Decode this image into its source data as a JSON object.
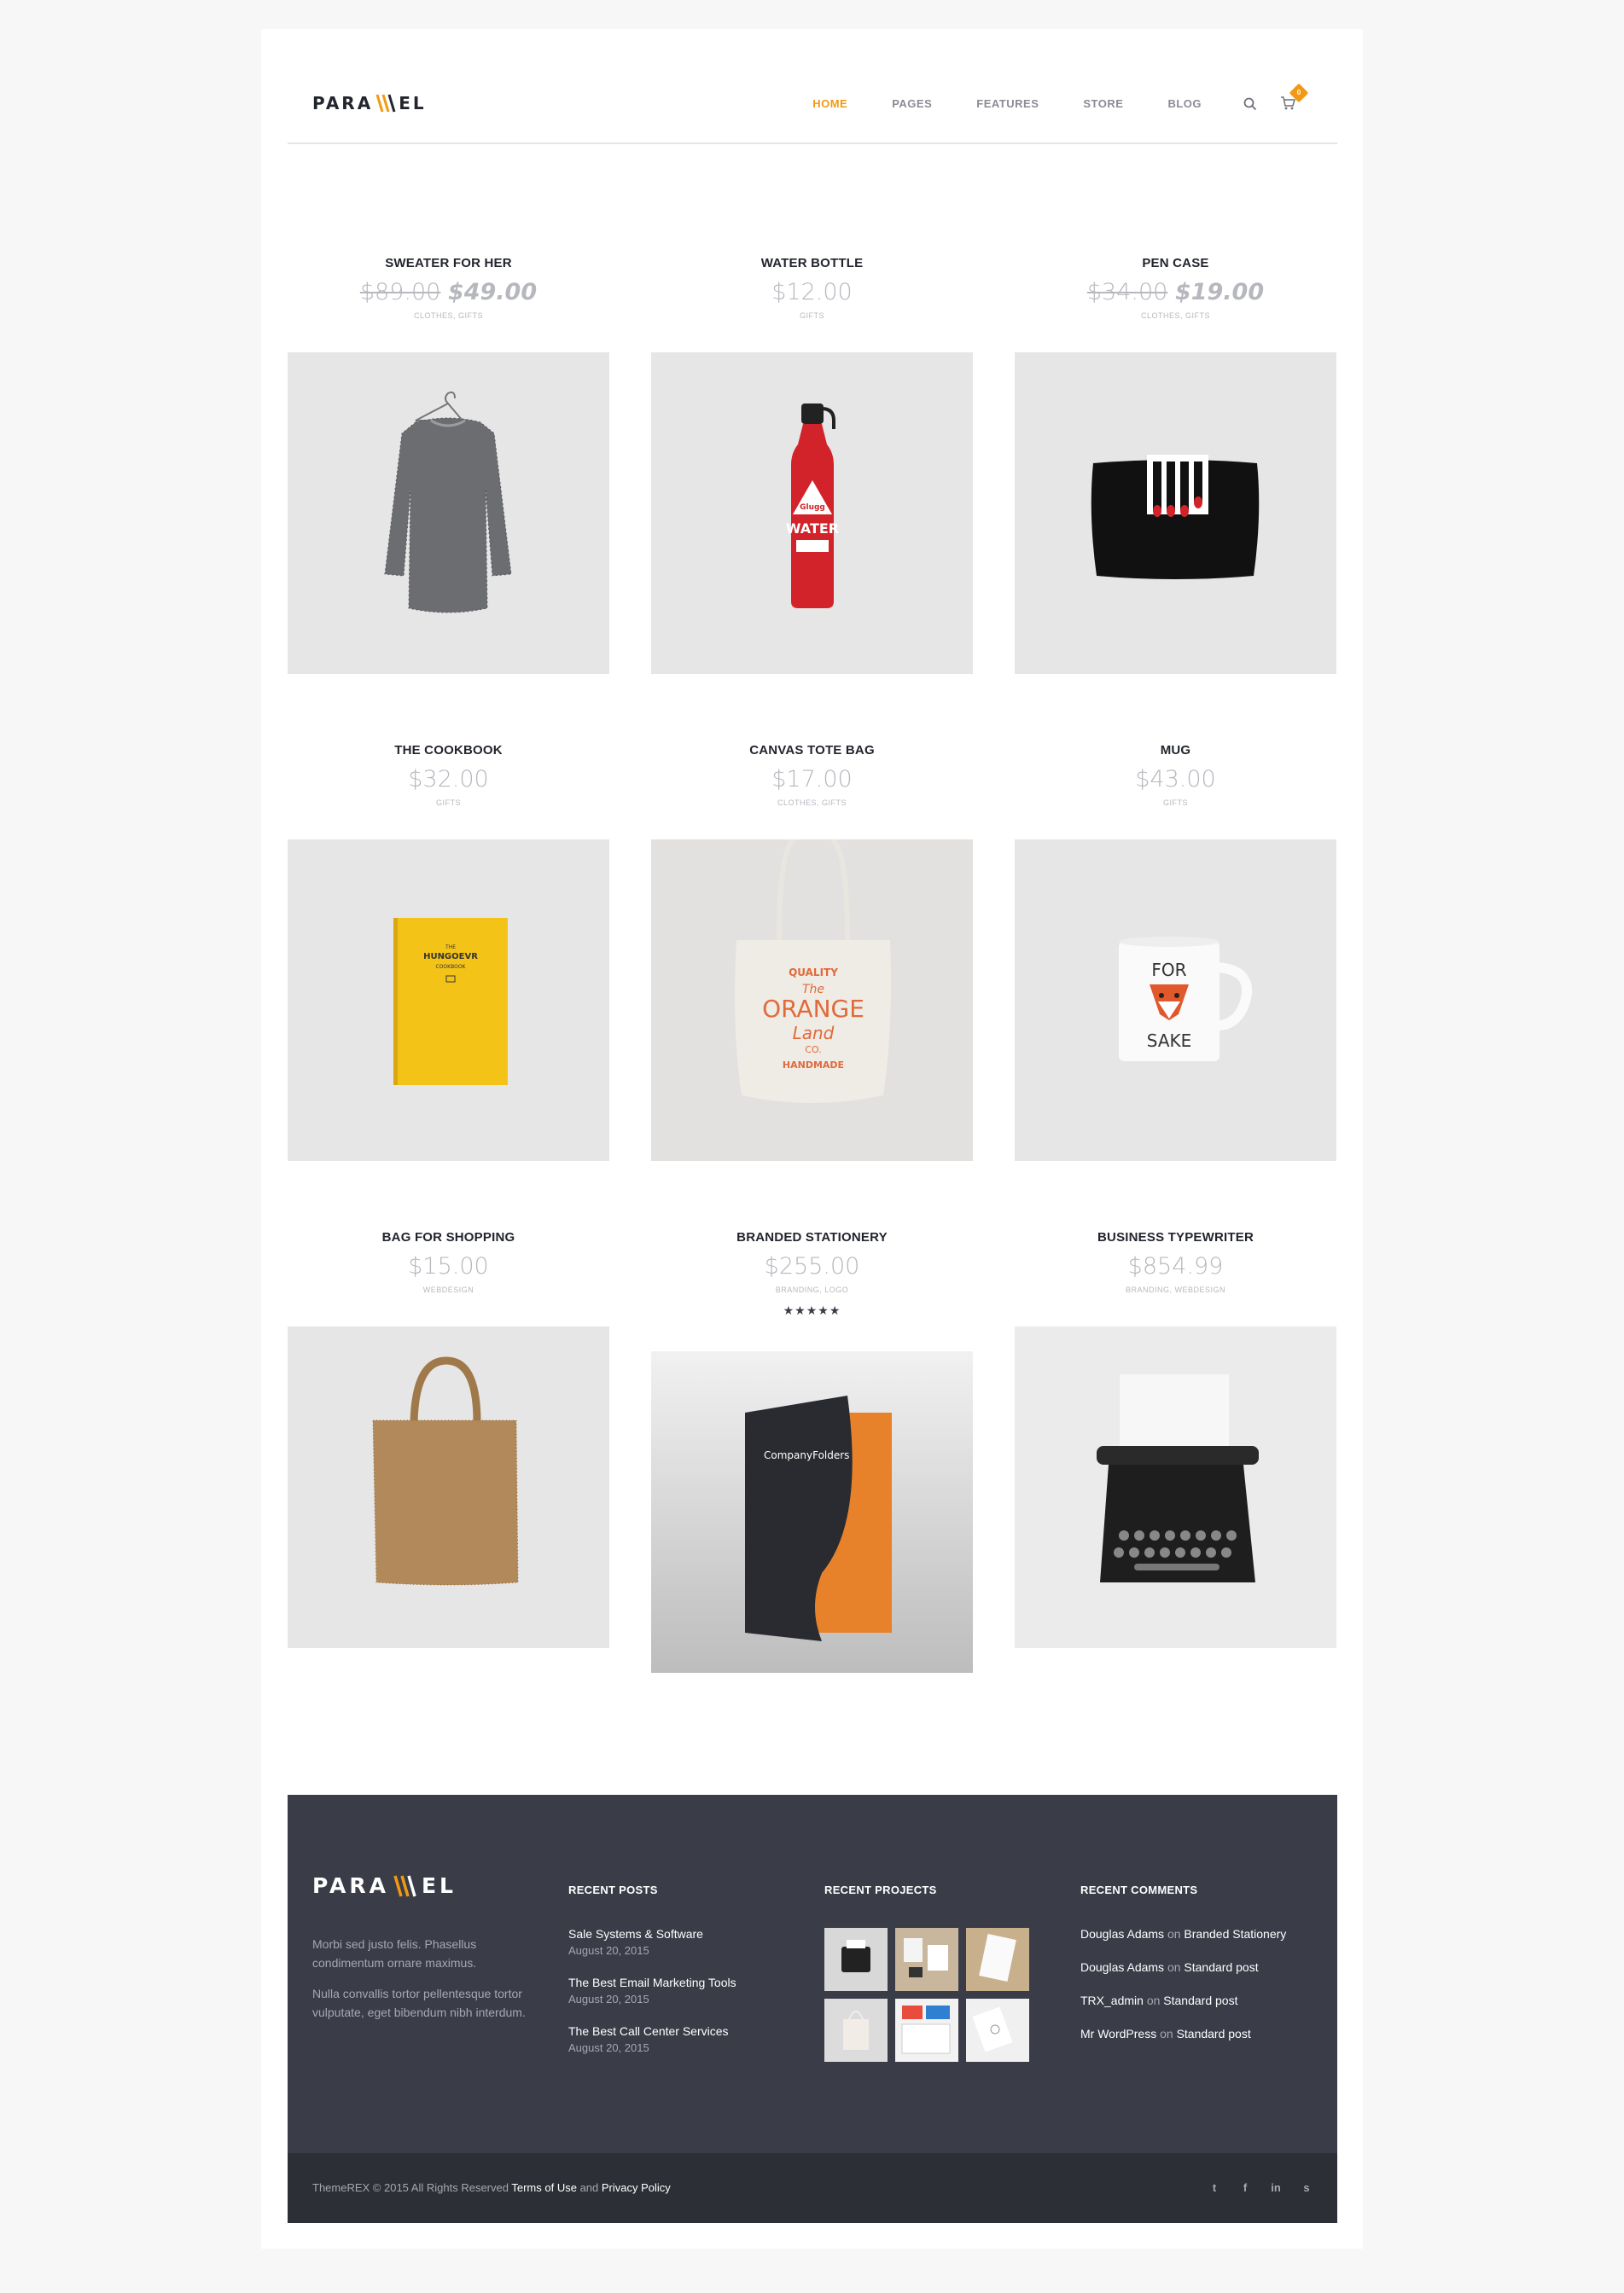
{
  "header": {
    "logo": "PARALLEL",
    "nav": [
      "HOME",
      "PAGES",
      "FEATURES",
      "STORE",
      "BLOG"
    ],
    "cart_count": "0",
    "accent_color": "#f19912"
  },
  "products": [
    {
      "title": "SWEATER FOR HER",
      "price_old": "$89.00",
      "price_new": "$49.00",
      "price": "",
      "cats": "CLOTHES, GIFTS",
      "rating": ""
    },
    {
      "title": "WATER BOTTLE",
      "price_old": "",
      "price_new": "",
      "price": "$12.00",
      "cats": "GIFTS",
      "rating": ""
    },
    {
      "title": "PEN CASE",
      "price_old": "$34.00",
      "price_new": "$19.00",
      "price": "",
      "cats": "CLOTHES, GIFTS",
      "rating": ""
    },
    {
      "title": "THE COOKBOOK",
      "price_old": "",
      "price_new": "",
      "price": "$32.00",
      "cats": "GIFTS",
      "rating": ""
    },
    {
      "title": "CANVAS TOTE BAG",
      "price_old": "",
      "price_new": "",
      "price": "$17.00",
      "cats": "CLOTHES, GIFTS",
      "rating": ""
    },
    {
      "title": "MUG",
      "price_old": "",
      "price_new": "",
      "price": "$43.00",
      "cats": "GIFTS",
      "rating": ""
    },
    {
      "title": "BAG FOR SHOPPING",
      "price_old": "",
      "price_new": "",
      "price": "$15.00",
      "cats": "WEBDESIGN",
      "rating": ""
    },
    {
      "title": "BRANDED STATIONERY",
      "price_old": "",
      "price_new": "",
      "price": "$255.00",
      "cats": "BRANDING, LOGO",
      "rating": "★★★★★"
    },
    {
      "title": "BUSINESS TYPEWRITER",
      "price_old": "",
      "price_new": "",
      "price": "$854.99",
      "cats": "BRANDING, WEBDESIGN",
      "rating": ""
    }
  ],
  "product_art": {
    "cookbook_title": "HUNGOEVR",
    "cookbook_sub": "COOKBOOK",
    "cookbook_small": "THE",
    "bottle_brand": "Glugg",
    "bottle_text": "WATER",
    "tote_lines": [
      "QUALITY",
      "The",
      "ORANGE",
      "Land",
      "CO.",
      "HANDMADE"
    ],
    "mug_lines": [
      "FOR",
      "SAKE"
    ],
    "folder_text": "CompanyFolders"
  },
  "footer": {
    "logo": "PARALLEL",
    "about": [
      "Morbi sed justo felis. Phasellus condimentum ornare maximus.",
      "Nulla convallis tortor pellentesque tortor vulputate, eget bibendum nibh interdum."
    ],
    "recent_posts_heading": "RECENT POSTS",
    "posts": [
      {
        "title": "Sale Systems & Software",
        "date": "August 20, 2015"
      },
      {
        "title": "The Best Email Marketing Tools",
        "date": "August 20, 2015"
      },
      {
        "title": "The Best Call Center Services",
        "date": "August 20, 2015"
      }
    ],
    "recent_projects_heading": "RECENT PROJECTS",
    "recent_comments_heading": "RECENT COMMENTS",
    "comments": [
      {
        "author": "Douglas Adams",
        "on": "on",
        "post": "Branded Stationery"
      },
      {
        "author": "Douglas Adams",
        "on": "on",
        "post": "Standard post"
      },
      {
        "author": "TRX_admin",
        "on": "on",
        "post": "Standard post"
      },
      {
        "author": "Mr WordPress",
        "on": "on",
        "post": "Standard post"
      }
    ],
    "copyright": "ThemeREX © 2015 All Rights Reserved",
    "terms": "Terms of Use",
    "and": "and",
    "privacy": "Privacy Policy",
    "social_icons": [
      "twitter-icon",
      "facebook-icon",
      "linkedin-icon",
      "skype-icon"
    ],
    "social_glyphs": [
      "t",
      "f",
      "in",
      "s"
    ]
  }
}
